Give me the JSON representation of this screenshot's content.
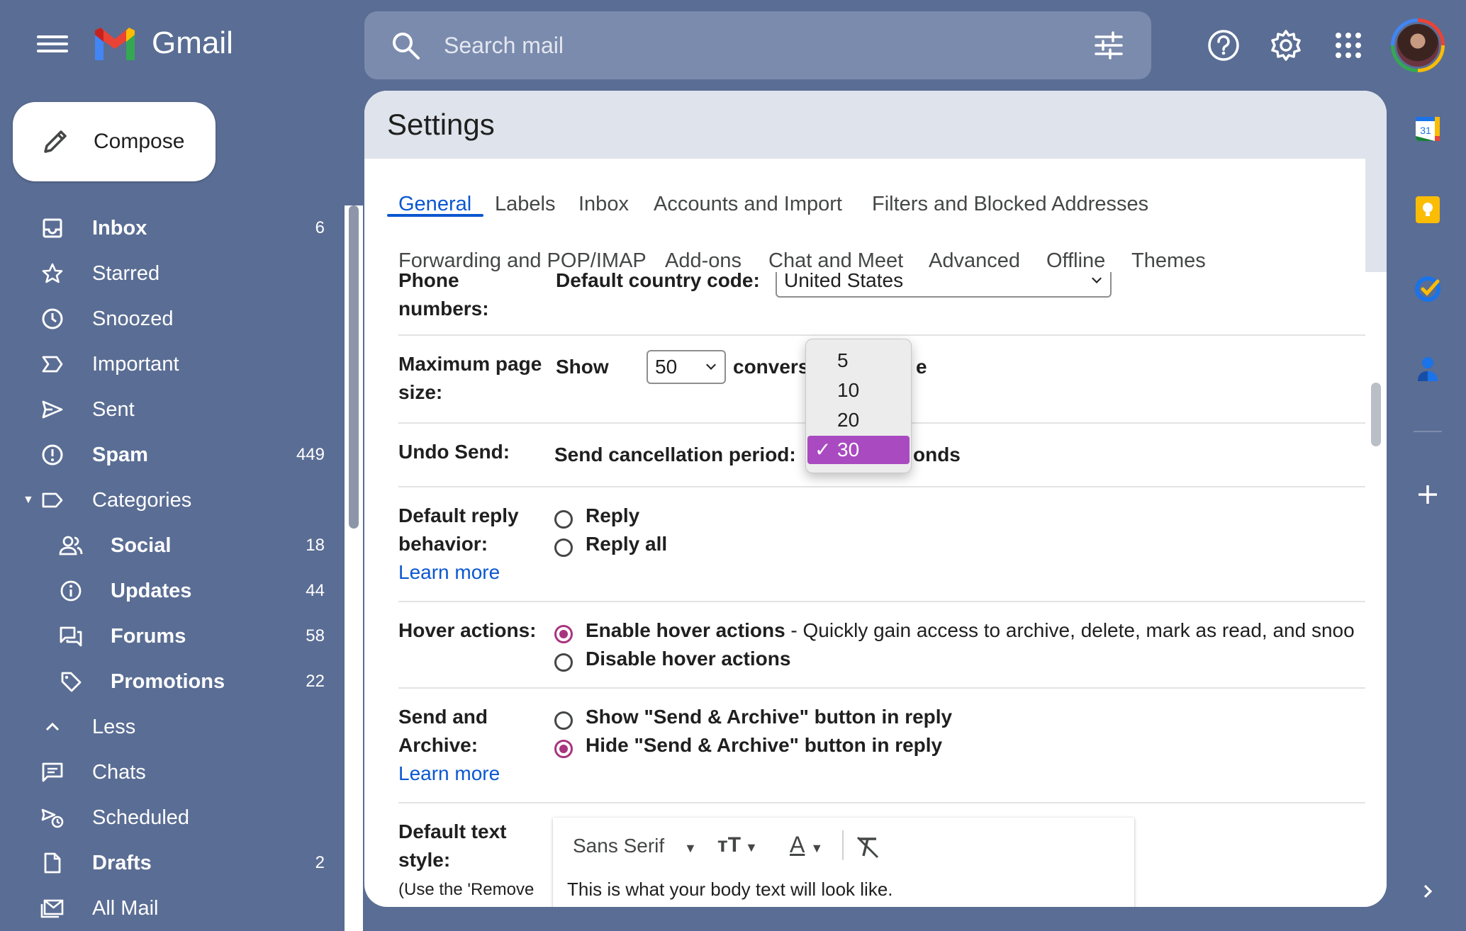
{
  "app": {
    "name": "Gmail"
  },
  "search": {
    "placeholder": "Search mail"
  },
  "compose": {
    "label": "Compose"
  },
  "nav": {
    "items": [
      {
        "label": "Inbox",
        "count": "6",
        "icon": "inbox-icon",
        "bold": true
      },
      {
        "label": "Starred",
        "count": "",
        "icon": "star-icon",
        "bold": false
      },
      {
        "label": "Snoozed",
        "count": "",
        "icon": "clock-icon",
        "bold": false
      },
      {
        "label": "Important",
        "count": "",
        "icon": "important-icon",
        "bold": false
      },
      {
        "label": "Sent",
        "count": "",
        "icon": "send-icon",
        "bold": false
      },
      {
        "label": "Spam",
        "count": "449",
        "icon": "spam-icon",
        "bold": true
      },
      {
        "label": "Categories",
        "count": "",
        "icon": "label-icon",
        "bold": false
      },
      {
        "label": "Social",
        "count": "18",
        "icon": "people-icon",
        "bold": true
      },
      {
        "label": "Updates",
        "count": "44",
        "icon": "info-icon",
        "bold": true
      },
      {
        "label": "Forums",
        "count": "58",
        "icon": "forum-icon",
        "bold": true
      },
      {
        "label": "Promotions",
        "count": "22",
        "icon": "tag-icon",
        "bold": true
      },
      {
        "label": "Less",
        "count": "",
        "icon": "chevron-up-icon",
        "bold": false
      },
      {
        "label": "Chats",
        "count": "",
        "icon": "chat-icon",
        "bold": false
      },
      {
        "label": "Scheduled",
        "count": "",
        "icon": "scheduled-send-icon",
        "bold": false
      },
      {
        "label": "Drafts",
        "count": "2",
        "icon": "draft-icon",
        "bold": true
      },
      {
        "label": "All Mail",
        "count": "",
        "icon": "all-mail-icon",
        "bold": false
      }
    ]
  },
  "settings": {
    "title": "Settings",
    "tabs": [
      "General",
      "Labels",
      "Inbox",
      "Accounts and Import",
      "Filters and Blocked Addresses",
      "Forwarding and POP/IMAP",
      "Add-ons",
      "Chat and Meet",
      "Advanced",
      "Offline",
      "Themes"
    ],
    "active_tab": "General",
    "phone": {
      "label_1": "Phone",
      "label_2": "numbers:",
      "field": "Default country code:",
      "value": "United States"
    },
    "page_size": {
      "label_1": "Maximum page",
      "label_2": "size:",
      "prefix": "Show",
      "value": "50",
      "suffix_visible_1": "conversatio",
      "suffix_visible_2": "e"
    },
    "undo_send": {
      "label": "Undo Send:",
      "field": "Send cancellation period:",
      "suffix_visible": "onds"
    },
    "dropdown": {
      "options": [
        "5",
        "10",
        "20",
        "30"
      ],
      "selected": "30",
      "check": "✓"
    },
    "reply": {
      "label_1": "Default reply",
      "label_2": "behavior:",
      "link": "Learn more",
      "options": [
        "Reply",
        "Reply all"
      ]
    },
    "hover": {
      "label": "Hover actions:",
      "enable": "Enable hover actions",
      "enable_desc": " - Quickly gain access to archive, delete, mark as read, and snoo",
      "disable": "Disable hover actions"
    },
    "send_archive": {
      "label_1": "Send and",
      "label_2": "Archive:",
      "link": "Learn more",
      "show": "Show \"Send & Archive\" button in reply",
      "hide": "Hide \"Send & Archive\" button in reply"
    },
    "text_style": {
      "label_1": "Default text",
      "label_2": "style:",
      "label_3": "(Use the 'Remove",
      "font": "Sans Serif",
      "preview": "This is what your body text will look like."
    }
  },
  "colors": {
    "accent": "#0b57d0",
    "radio": "#a8347e",
    "highlight": "#a94ac1",
    "background": "#5a6d94"
  }
}
